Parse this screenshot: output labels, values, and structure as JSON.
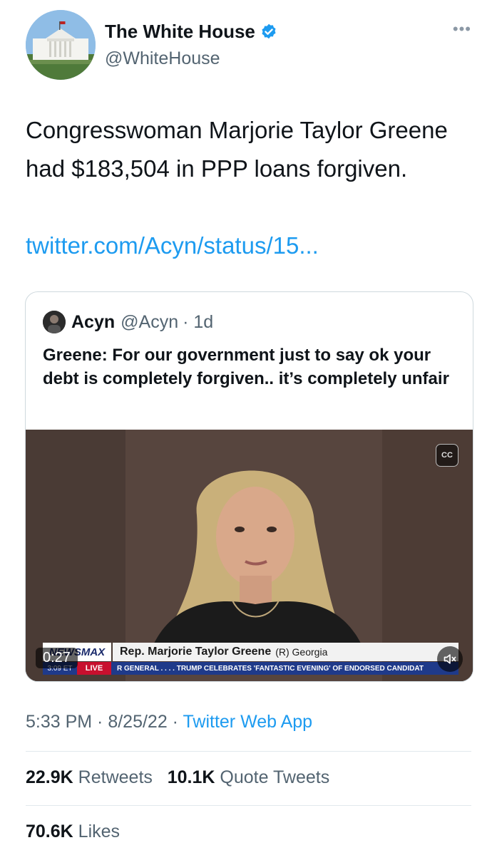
{
  "author": {
    "display_name": "The White House",
    "handle": "@WhiteHouse",
    "verified": true
  },
  "more_icon": "more-horizontal-icon",
  "tweet": {
    "text": "Congresswoman Marjorie Taylor Greene had $183,504 in PPP loans forgiven.",
    "link": "twitter.com/Acyn/status/15..."
  },
  "quote": {
    "name": "Acyn",
    "handle": "@Acyn",
    "age": "· 1d",
    "text": "Greene: For our government just to say ok your debt is completely forgiven.. it’s completely unfair",
    "video": {
      "duration": "0:27",
      "brand": "NEWSMAX",
      "lower_third_name": "Rep. Marjorie Taylor Greene",
      "lower_third_region": "(R) Georgia",
      "time_tag": "3:09 ET",
      "live_tag": "LIVE",
      "ticker": "R GENERAL . . . .    TRUMP CELEBRATES 'FANTASTIC EVENING' OF ENDORSED CANDIDAT",
      "icons": [
        "closed-captions-icon",
        "mute-icon"
      ]
    }
  },
  "meta": {
    "time": "5:33 PM · 8/25/22 ·",
    "app": "Twitter Web App"
  },
  "stats": {
    "retweets_count": "22.9K",
    "retweets_label": "Retweets",
    "quotes_count": "10.1K",
    "quotes_label": "Quote Tweets",
    "likes_count": "70.6K",
    "likes_label": "Likes"
  },
  "colors": {
    "link": "#1d9bf0",
    "muted": "#536471",
    "text": "#0f1419"
  }
}
